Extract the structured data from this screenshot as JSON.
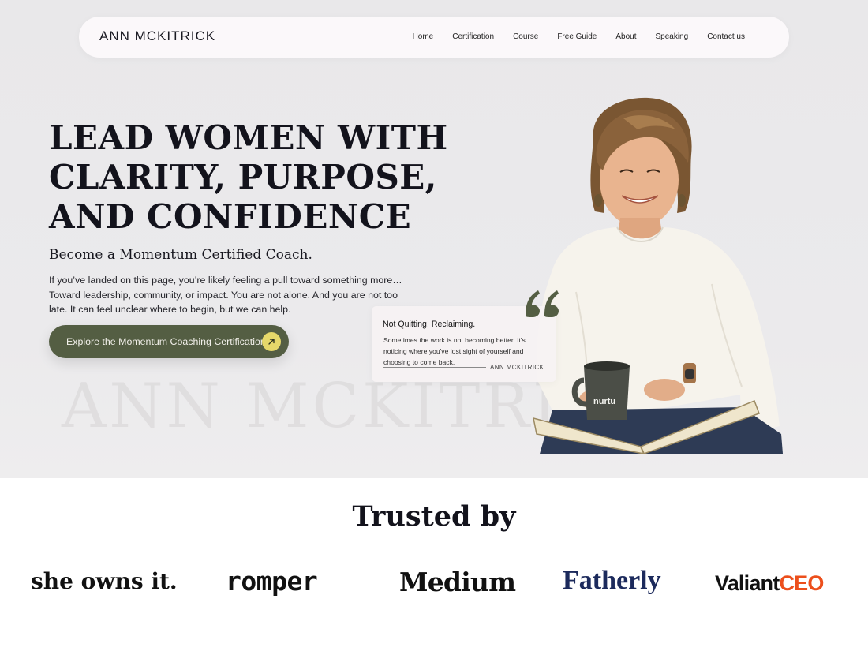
{
  "nav": {
    "logo": "ANN MCKITRICK",
    "links": [
      "Home",
      "Certification",
      "Course",
      "Free Guide",
      "About",
      "Speaking",
      "Contact us"
    ]
  },
  "hero": {
    "headline": [
      "LEAD WOMEN WITH",
      "CLARITY, PURPOSE,",
      "AND CONFIDENCE"
    ],
    "subhead": "Become a Momentum Certified Coach.",
    "body": "If you’ve landed on this page, you’re likely feeling a pull toward something more… Toward leadership, community, or impact. You are not alone. And you are not too late. It can feel unclear where to begin, but we can help.",
    "cta_label": "Explore the Momentum Coaching Certification",
    "watermark": "ANN MCKITRICK",
    "mug_text": "nurtu"
  },
  "quote": {
    "title": "Not Quitting. Reclaiming.",
    "text": "Sometimes the work is not becoming better. It's noticing where you've lost sight of yourself and choosing to come back.",
    "author": "ANN MCKITRICK"
  },
  "trusted": {
    "title": "Trusted by",
    "brands": [
      "she owns it.",
      "romper",
      "Medium",
      "Fatherly",
      "Valiant",
      "CEO"
    ]
  },
  "colors": {
    "accent_green": "#545e43",
    "arrow_yellow": "#e6d86a",
    "valiant_orange": "#ec4f1c",
    "fatherly_navy": "#1c2a5c"
  },
  "icons": [
    "arrow-up-right-icon",
    "quote-mark-icon"
  ]
}
